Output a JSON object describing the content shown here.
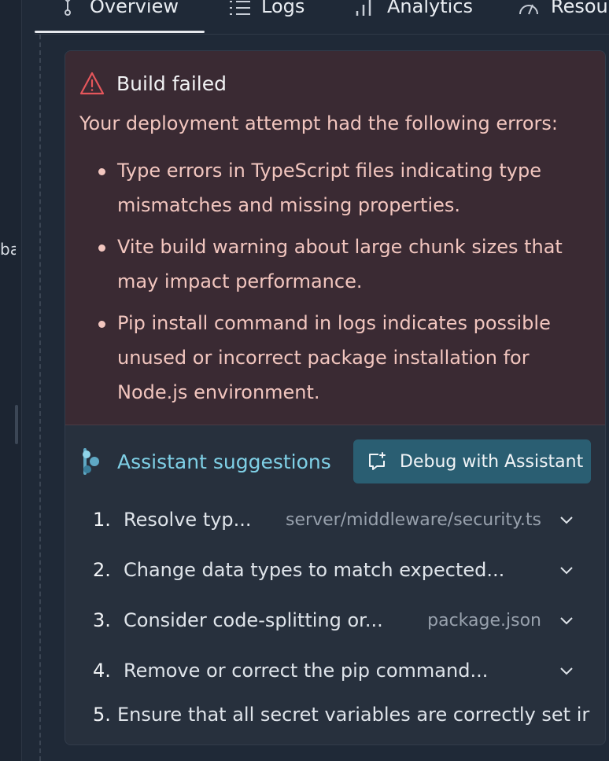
{
  "left_strip": {
    "cut_text": "ba"
  },
  "tabs": [
    {
      "label": "Overview",
      "icon": "branch-icon",
      "active": true
    },
    {
      "label": "Logs",
      "icon": "list-icon"
    },
    {
      "label": "Analytics",
      "icon": "bar-chart-icon"
    },
    {
      "label": "Resou",
      "icon": "gauge-icon"
    }
  ],
  "error": {
    "title": "Build failed",
    "intro": "Your deployment attempt had the following errors:",
    "items": [
      "Type errors in TypeScript files indicating type mismatches and missing properties.",
      "Vite build warning about large chunk sizes that may impact performance.",
      "Pip install command in logs indicates possible unused or incorrect package installation for Node.js environment."
    ],
    "colors": {
      "panel": "#3a2a33",
      "text": "#f2c6bf",
      "icon": "#e5565b"
    }
  },
  "assistant": {
    "title": "Assistant suggestions",
    "debug_button": "Debug with Assistant",
    "accent": "#7fd0e6",
    "suggestions": [
      {
        "num": "1.",
        "text": "Resolve typ...",
        "file": "server/middleware/security.ts"
      },
      {
        "num": "2.",
        "text": "Change data types to match expected...",
        "file": ""
      },
      {
        "num": "3.",
        "text": "Consider code-splitting or...",
        "file": "package.json"
      },
      {
        "num": "4.",
        "text": "Remove or correct the pip command...",
        "file": ""
      },
      {
        "num": "5.",
        "text": "Ensure that all secret variables are correctly set ir",
        "file": ""
      }
    ]
  }
}
